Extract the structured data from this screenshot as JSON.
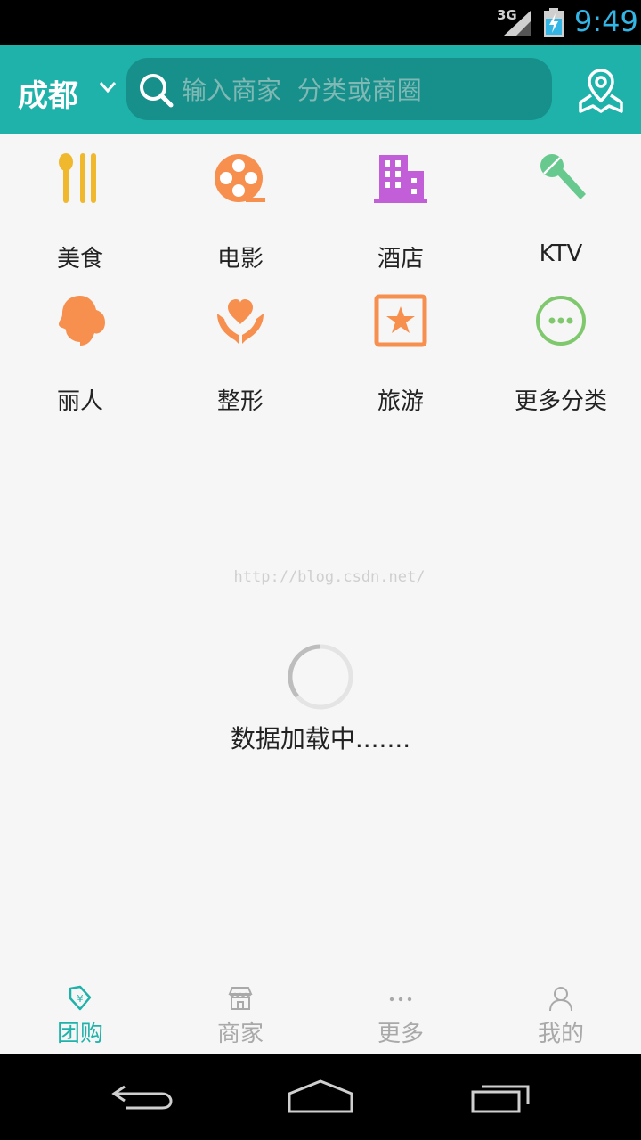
{
  "status_bar": {
    "network": "3G",
    "time": "9:49"
  },
  "top_bar": {
    "city": "成都",
    "search_placeholder": "输入商家  分类或商圈"
  },
  "categories": [
    {
      "label": "美食",
      "icon": "fork-spoon-icon",
      "color": "#f0b82d"
    },
    {
      "label": "电影",
      "icon": "film-reel-icon",
      "color": "#f78f4f"
    },
    {
      "label": "酒店",
      "icon": "building-icon",
      "color": "#c15ed8"
    },
    {
      "label": "KTV",
      "icon": "microphone-icon",
      "color": "#67c98e"
    },
    {
      "label": "丽人",
      "icon": "woman-head-icon",
      "color": "#f78f4f"
    },
    {
      "label": "整形",
      "icon": "heart-hands-icon",
      "color": "#f78f4f"
    },
    {
      "label": "旅游",
      "icon": "star-box-icon",
      "color": "#f78f4f"
    },
    {
      "label": "更多分类",
      "icon": "more-circle-icon",
      "color": "#7fc86e"
    }
  ],
  "watermark": "http://blog.csdn.net/",
  "loading_text": "数据加载中.......",
  "tabs": [
    {
      "label": "团购",
      "icon": "tag-icon",
      "active": true
    },
    {
      "label": "商家",
      "icon": "storefront-icon",
      "active": false
    },
    {
      "label": "更多",
      "icon": "more-dots-icon",
      "active": false
    },
    {
      "label": "我的",
      "icon": "user-icon",
      "active": false
    }
  ],
  "colors": {
    "accent": "#1fb2aa",
    "tab_inactive": "#a9a9a9"
  }
}
